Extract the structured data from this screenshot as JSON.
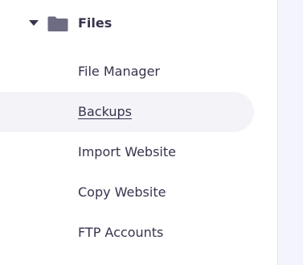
{
  "section": {
    "title": "Files",
    "icon": "folder-icon",
    "expanded": true
  },
  "items": [
    {
      "label": "File Manager",
      "active": false
    },
    {
      "label": "Backups",
      "active": true
    },
    {
      "label": "Import Website",
      "active": false
    },
    {
      "label": "Copy Website",
      "active": false
    },
    {
      "label": "FTP Accounts",
      "active": false
    }
  ],
  "colors": {
    "text": "#36344d",
    "icon": "#6d6c82",
    "active_bg": "#f4f4f8",
    "content_bg": "#f4f4fc"
  }
}
